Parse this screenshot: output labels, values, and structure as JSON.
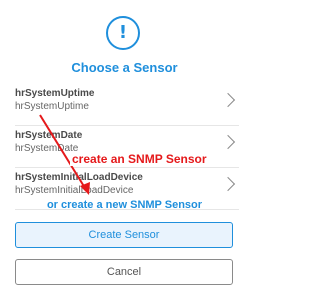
{
  "dialog": {
    "info_icon": "!",
    "title": "Choose a Sensor"
  },
  "sensors": [
    {
      "name": "hrSystemUptime",
      "id": "hrSystemUptime"
    },
    {
      "name": "hrSystemDate",
      "id": "hrSystemDate"
    },
    {
      "name": "hrSystemInitialLoadDevice",
      "id": "hrSystemInitialLoadDevice"
    }
  ],
  "annotation": {
    "label": "create an SNMP Sensor",
    "color": "#e5191b"
  },
  "links": {
    "new_sensor": "or create a new SNMP Sensor"
  },
  "buttons": {
    "create": "Create Sensor",
    "cancel": "Cancel"
  },
  "colors": {
    "accent": "#1f8fdc",
    "annotation": "#e5191b"
  }
}
